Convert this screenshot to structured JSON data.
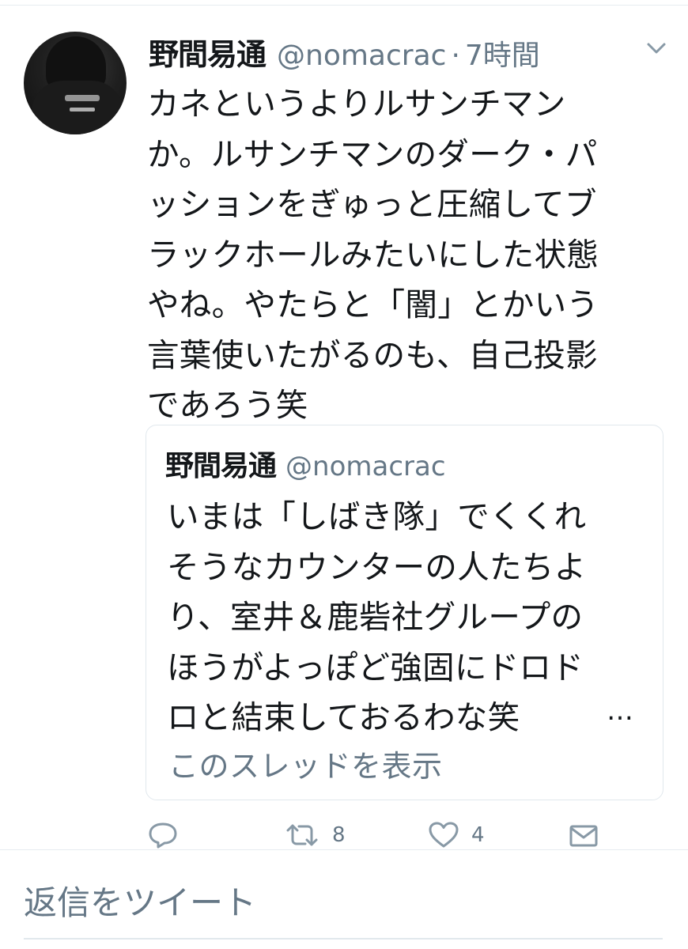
{
  "tweet": {
    "author_name": "野間易通",
    "author_handle": "@nomacrac",
    "separator": "·",
    "time": "7時間",
    "text_lines": [
      "カネというよりルサンチマン",
      "か。ルサンチマンのダーク・パ",
      "ッションをぎゅっと圧縮してブ",
      "ラックホールみたいにした状態",
      "やね。やたらと「闇」とかいう",
      "言葉使いたがるのも、自己投影",
      "であろう笑"
    ]
  },
  "quoted_tweet": {
    "author_name": "野間易通",
    "author_handle": "@nomacrac",
    "text_lines": [
      "いまは「しばき隊」でくくれ",
      "そうなカウンターの人たちよ",
      "り、室井＆鹿砦社グループの",
      "ほうがよっぽど強固にドロド",
      "ロと結束しておるわな笑"
    ],
    "ellipsis": "…",
    "show_thread_label": "このスレッドを表示"
  },
  "actions": {
    "reply_icon": "reply-icon",
    "retweet_icon": "retweet-icon",
    "retweet_count": "8",
    "like_icon": "heart-icon",
    "like_count": "4",
    "dm_icon": "mail-icon"
  },
  "reply_box": {
    "placeholder": "返信をツイート"
  },
  "colors": {
    "text": "#14171a",
    "secondary": "#657786",
    "border": "#e1e8ed"
  }
}
